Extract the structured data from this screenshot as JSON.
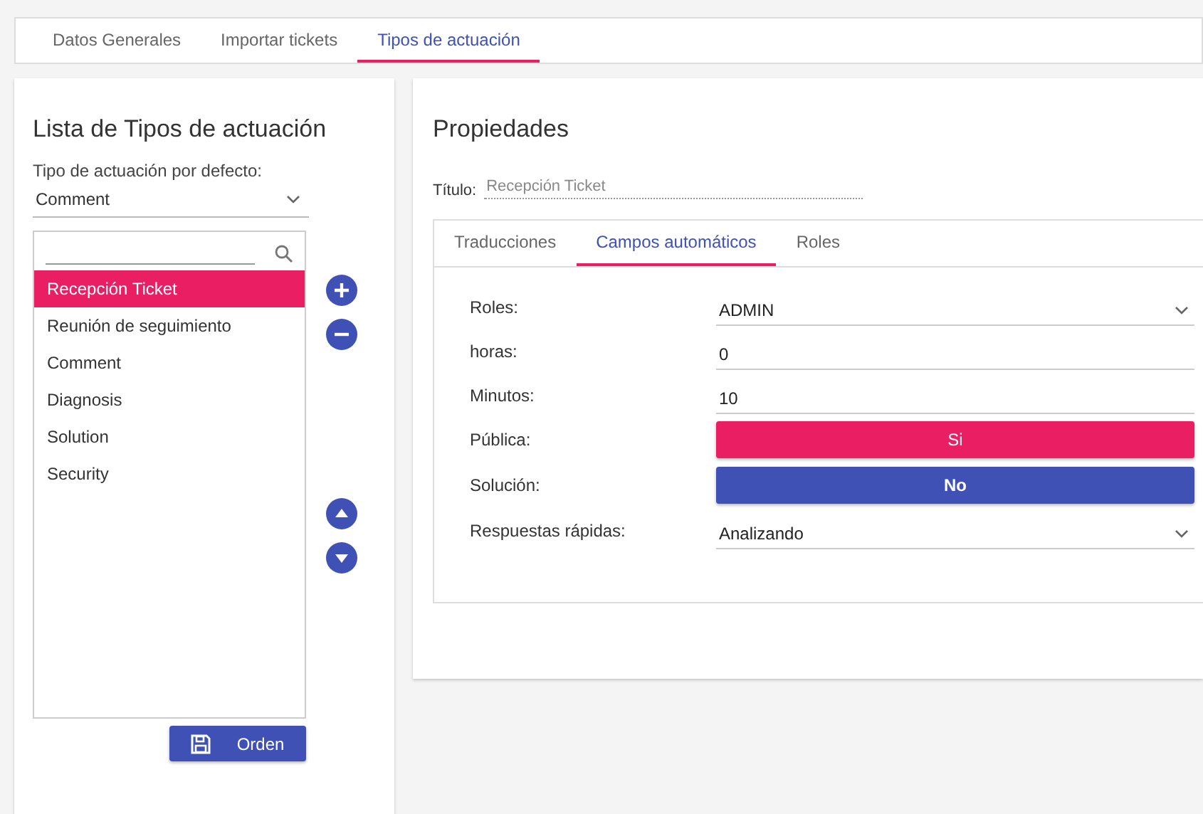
{
  "tabs": [
    {
      "label": "Datos Generales",
      "selected": false
    },
    {
      "label": "Importar tickets",
      "selected": false
    },
    {
      "label": "Tipos de actuación",
      "selected": true
    }
  ],
  "list_panel": {
    "title": "Lista de Tipos de actuación",
    "default_label": "Tipo de actuación por defecto:",
    "default_value": "Comment",
    "items": [
      {
        "label": "Recepción Ticket",
        "selected": true
      },
      {
        "label": "Reunión de seguimiento",
        "selected": false
      },
      {
        "label": "Comment",
        "selected": false
      },
      {
        "label": "Diagnosis",
        "selected": false
      },
      {
        "label": "Solution",
        "selected": false
      },
      {
        "label": "Security",
        "selected": false
      }
    ],
    "order_button": "Orden"
  },
  "properties": {
    "title": "Propiedades",
    "title_label": "Título:",
    "title_placeholder": "Recepción Ticket",
    "tabs": [
      {
        "label": "Traducciones",
        "selected": false
      },
      {
        "label": "Campos automáticos",
        "selected": true
      },
      {
        "label": "Roles",
        "selected": false
      }
    ],
    "fields": [
      {
        "kind": "select",
        "label": "Roles:",
        "value": "ADMIN"
      },
      {
        "kind": "input",
        "label": "horas:",
        "value": "0"
      },
      {
        "kind": "input",
        "label": "Minutos:",
        "value": "10"
      },
      {
        "kind": "toggle",
        "label": "Pública:",
        "value": "Si",
        "on": true
      },
      {
        "kind": "toggle",
        "label": "Solución:",
        "value": "No",
        "on": false
      },
      {
        "kind": "select",
        "label": "Respuestas rápidas:",
        "value": "Analizando"
      }
    ]
  }
}
